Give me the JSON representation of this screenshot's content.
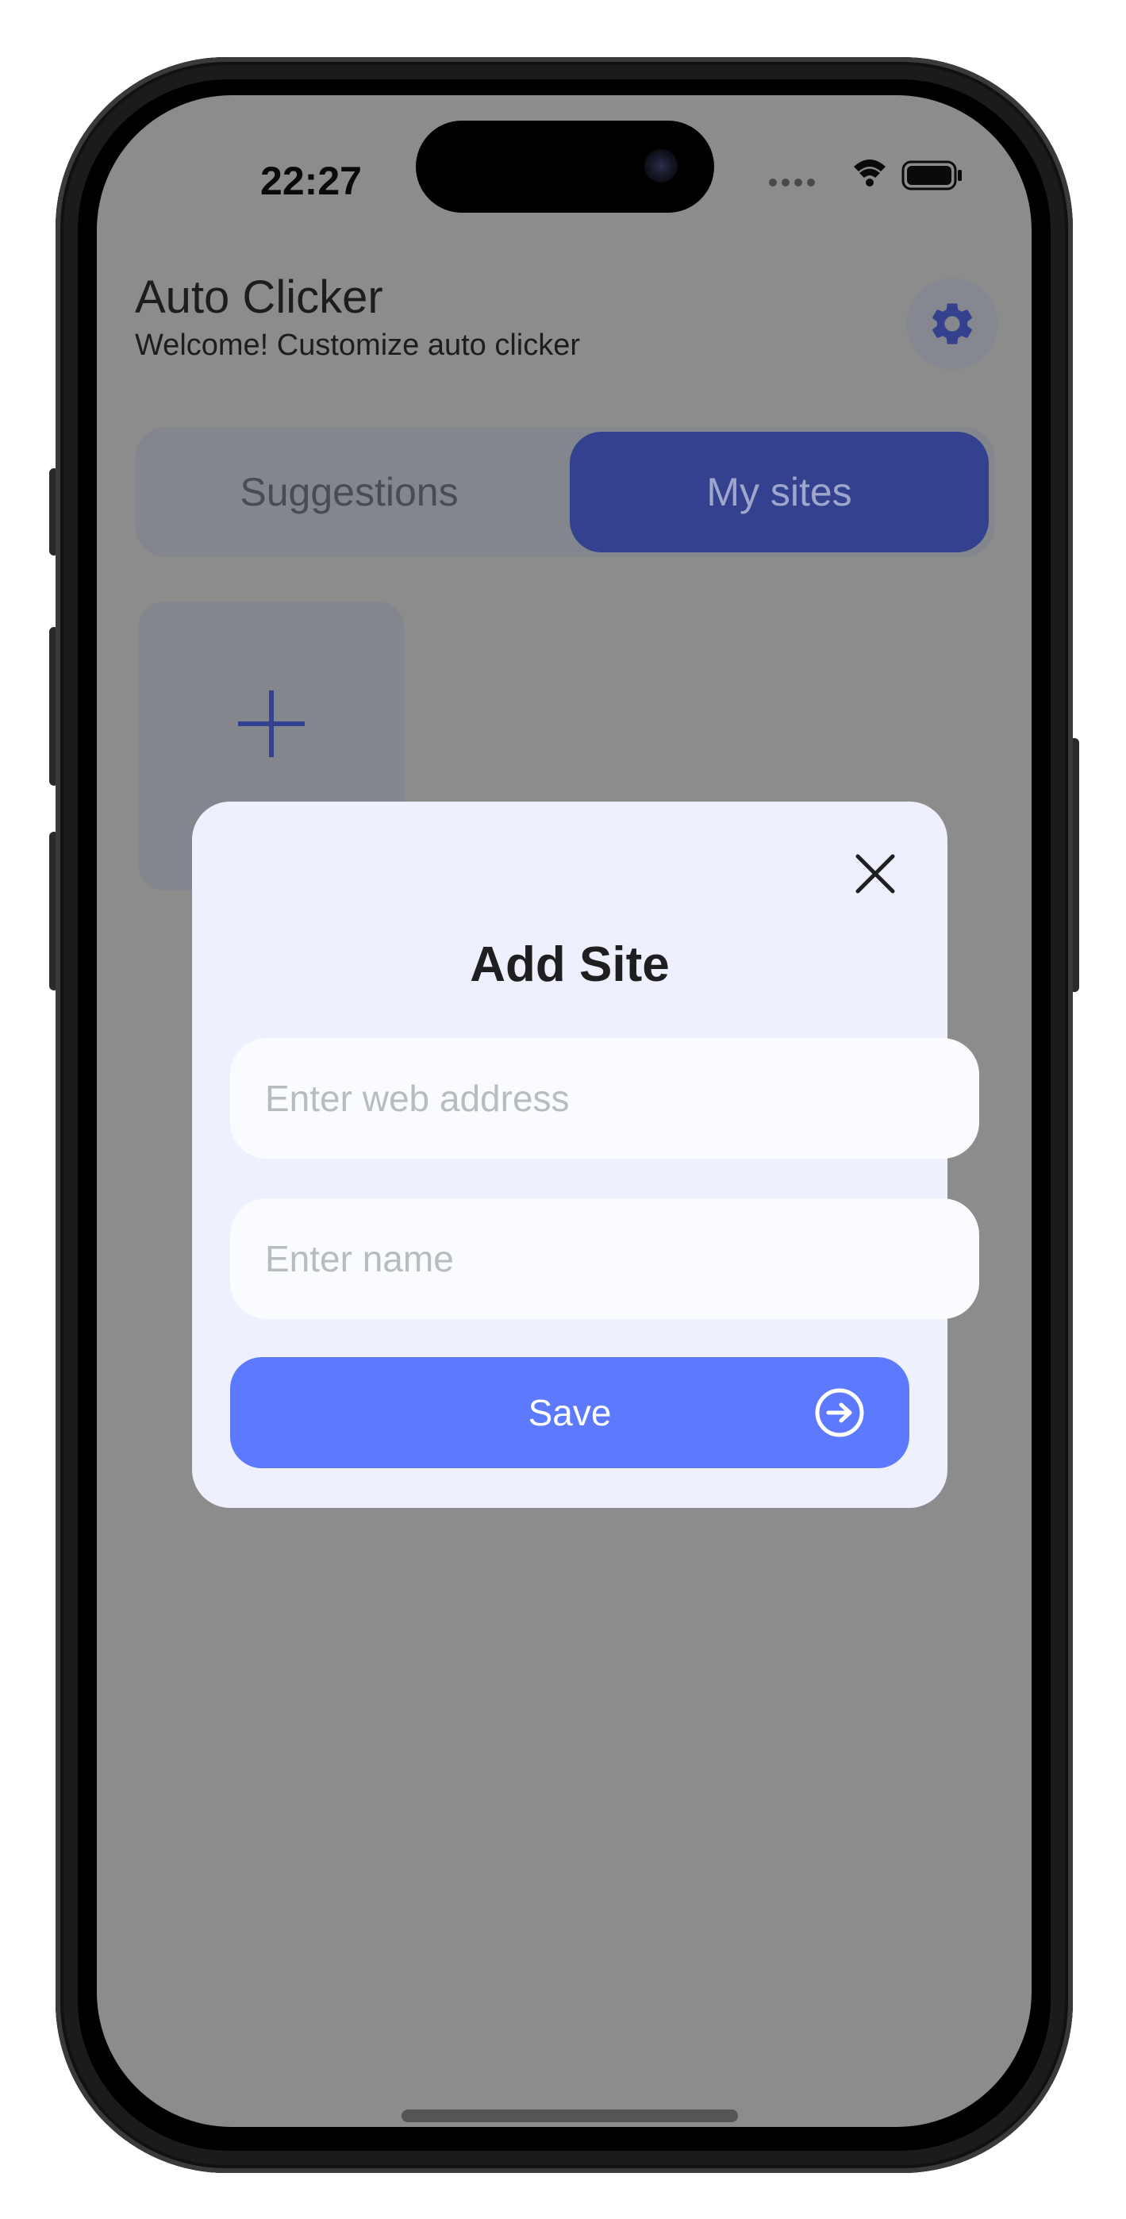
{
  "status_bar": {
    "time": "22:27",
    "icons": [
      "signal-dots-icon",
      "wifi-icon",
      "battery-icon"
    ]
  },
  "header": {
    "title": "Auto Clicker",
    "subtitle": "Welcome! Customize auto clicker",
    "settings_icon": "gear-icon"
  },
  "tabs": [
    {
      "label": "Suggestions",
      "selected": false
    },
    {
      "label": "My sites",
      "selected": true
    }
  ],
  "add_tile": {
    "icon": "plus-icon"
  },
  "modal": {
    "title": "Add Site",
    "close_icon": "close-icon",
    "web_address": {
      "value": "",
      "placeholder": "Enter web address"
    },
    "name": {
      "value": "",
      "placeholder": "Enter name"
    },
    "save_label": "Save",
    "save_icon": "arrow-right-circle-icon"
  },
  "colors": {
    "accent": "#5d79fd",
    "tab_selected": "#33418f",
    "modal_bg": "#eef0fd",
    "overlay": "#8c8c8c"
  }
}
